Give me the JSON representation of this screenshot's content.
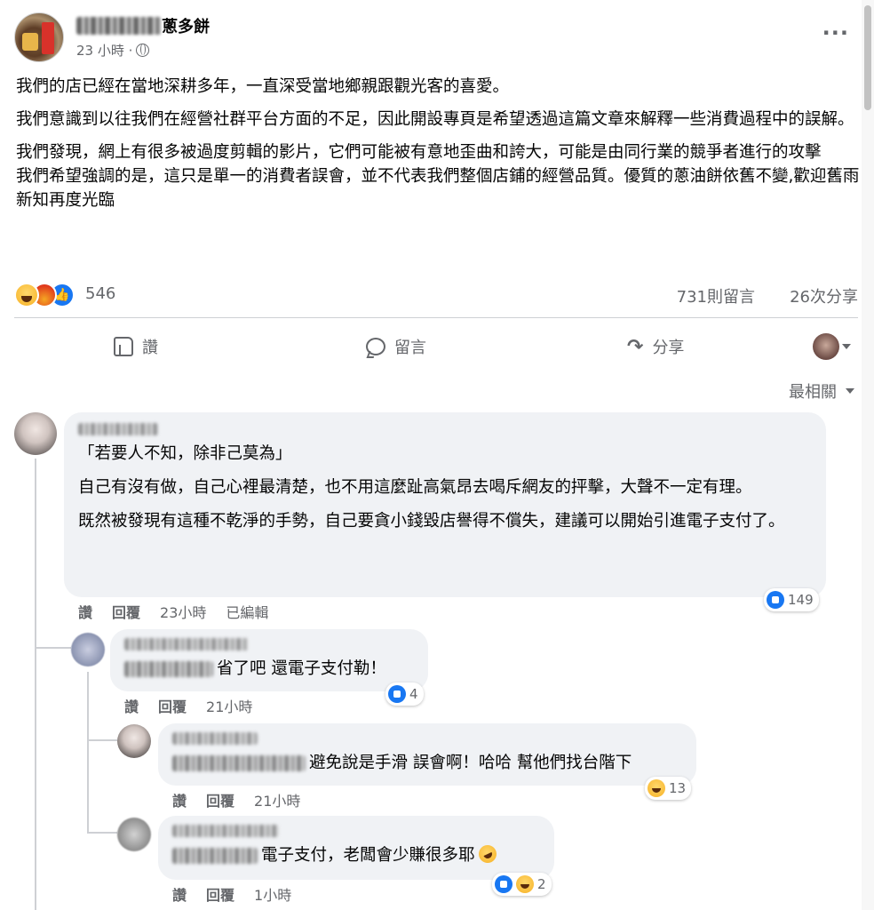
{
  "post": {
    "page_name": "蔥多餅",
    "time": "23 小時",
    "paragraphs": [
      "我們的店已經在當地深耕多年，一直深受當地鄉親跟觀光客的喜愛。",
      "我們意識到以往我們在經營社群平台方面的不足，因此開設專頁是希望透過這篇文章來解釋一些消費過程中的誤解。",
      "我們發現，網上有很多被過度剪輯的影片，它們可能被有意地歪曲和誇大，可能是由同行業的競爭者進行的攻擊",
      "我們希望強調的是，這只是單一的消費者誤會，並不代表我們整個店鋪的經營品質。優質的蔥油餅依舊不變,歡迎舊雨新知再度光臨"
    ],
    "reaction_count": "546",
    "comment_count": "731則留言",
    "share_count": "26次分享"
  },
  "actions": {
    "like": "讚",
    "comment": "留言",
    "share": "分享"
  },
  "sort_label": "最相關",
  "comments": [
    {
      "paragraphs": [
        "「若要人不知，除非己莫為」",
        "自己有沒有做，自己心裡最清楚，也不用這麼趾高氣昂去喝斥網友的抨擊，大聲不一定有理。",
        "既然被發現有這種不乾淨的手勢，自己要貪小錢毀店譽得不償失，建議可以開始引進電子支付了。"
      ],
      "like": "讚",
      "reply": "回覆",
      "time": "23小時",
      "edited": "已編輯",
      "reactions": "149"
    },
    {
      "text": "省了吧 還電子支付勒！",
      "like": "讚",
      "reply": "回覆",
      "time": "21小時",
      "reactions": "4"
    },
    {
      "text": "避免說是手滑 誤會啊！哈哈 幫他們找台階下",
      "like": "讚",
      "reply": "回覆",
      "time": "21小時",
      "reactions": "13"
    },
    {
      "text": "電子支付，老闆會少賺很多耶",
      "like": "讚",
      "reply": "回覆",
      "time": "1小時",
      "reactions": "2"
    }
  ],
  "icons": {
    "globe": "globe-icon",
    "more": "more-icon",
    "like": "thumb-up-icon",
    "comment": "comment-bubble-icon",
    "share": "share-arrow-icon"
  },
  "colors": {
    "accent": "#1877f2",
    "secondary_text": "#65676b",
    "bubble_bg": "#f0f2f5"
  }
}
